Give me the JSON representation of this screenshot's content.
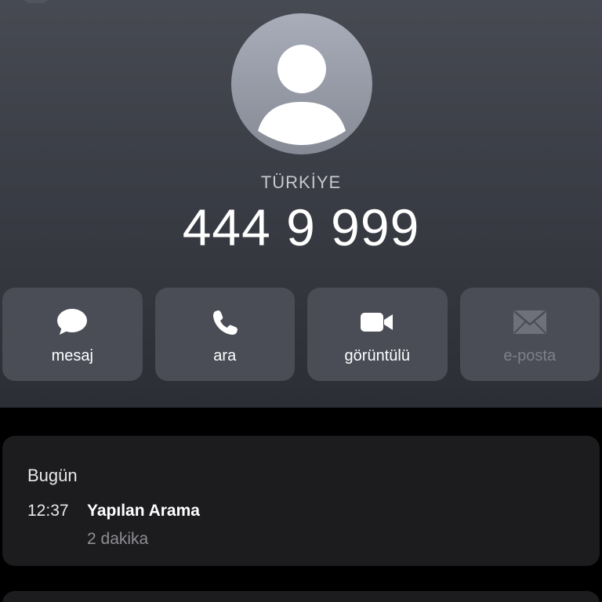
{
  "contact": {
    "label": "TÜRKİYE",
    "number": "444 9 999",
    "avatar_icon": "person-silhouette-icon"
  },
  "actions": [
    {
      "label": "mesaj",
      "icon": "message-bubble-icon",
      "enabled": true
    },
    {
      "label": "ara",
      "icon": "phone-icon",
      "enabled": true
    },
    {
      "label": "görüntülü",
      "icon": "video-camera-icon",
      "enabled": true
    },
    {
      "label": "e-posta",
      "icon": "envelope-icon",
      "enabled": false
    }
  ],
  "call_history": {
    "day": "Bugün",
    "entries": [
      {
        "time": "12:37",
        "type": "Yapılan Arama",
        "duration": "2 dakika"
      }
    ]
  },
  "colors": {
    "header_top": "#474a52",
    "header_bottom": "#2c2e35",
    "action_bg": "#4a4d56",
    "card_bg": "#1c1c1e",
    "secondary_text": "#8e8e93"
  }
}
